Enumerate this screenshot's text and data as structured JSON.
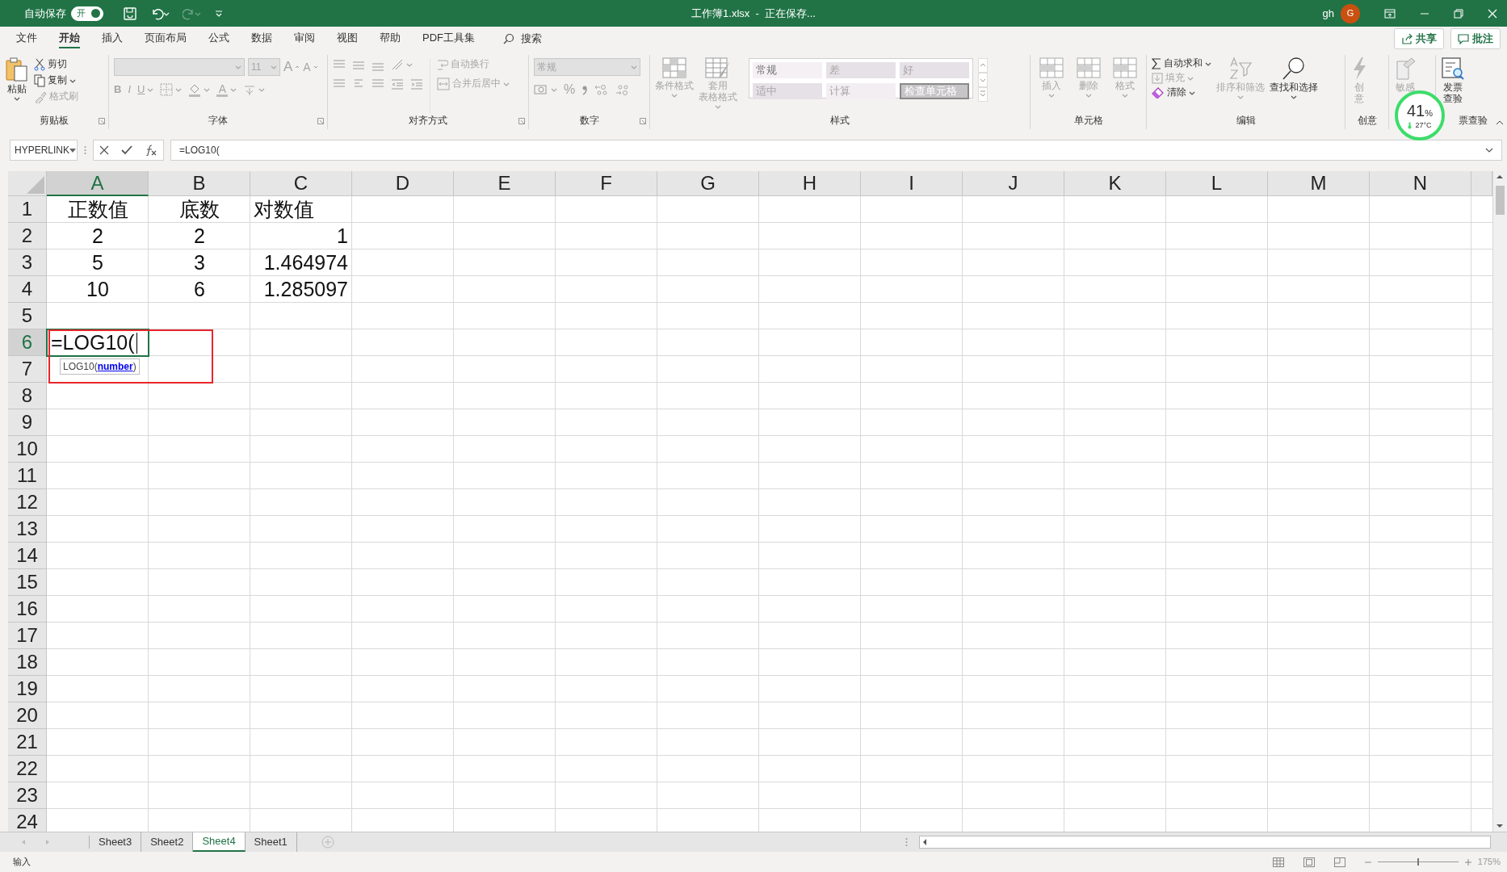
{
  "title_bar": {
    "autosave_label": "自动保存",
    "autosave": {
      "label": "开",
      "on": true
    },
    "title": "工作簿1.xlsx  -  正在保存...",
    "user": "gh",
    "avatar": "G"
  },
  "menu_tabs": [
    {
      "label": "文件",
      "selected": false
    },
    {
      "label": "开始",
      "selected": true
    },
    {
      "label": "插入",
      "selected": false
    },
    {
      "label": "页面布局",
      "selected": false
    },
    {
      "label": "公式",
      "selected": false
    },
    {
      "label": "数据",
      "selected": false
    },
    {
      "label": "审阅",
      "selected": false
    },
    {
      "label": "视图",
      "selected": false
    },
    {
      "label": "帮助",
      "selected": false
    },
    {
      "label": "PDF工具集",
      "selected": false
    }
  ],
  "search": {
    "label": "搜索"
  },
  "share_button": "共享",
  "comments_button": "批注",
  "ribbon": [
    {
      "kind": "clipboard",
      "label": "剪贴板",
      "paste": "粘贴",
      "items": [
        {
          "label": "剪切",
          "disabled": false
        },
        {
          "label": "复制",
          "disabled": false
        },
        {
          "label": "格式刷",
          "disabled": true
        }
      ]
    },
    {
      "kind": "font",
      "label": "字体",
      "font_size": "11",
      "size_buttons": [
        "A",
        "A"
      ],
      "style_buttons": [
        "B",
        "I",
        "U"
      ],
      "color_button": "A"
    },
    {
      "kind": "alignment",
      "label": "对齐方式",
      "wrap": "自动换行",
      "merge": "合并后居中"
    },
    {
      "kind": "number",
      "label": "数字",
      "format": "常规",
      "percent": "%"
    },
    {
      "kind": "styles",
      "label": "样式",
      "buttons": [
        {
          "lines": [
            "条件格式"
          ]
        },
        {
          "lines": [
            "套用",
            "表格格式"
          ]
        }
      ],
      "cell_styles": [
        {
          "label": "常规",
          "color": "#f4f0f4"
        },
        {
          "label": "差",
          "color": "#e6e1e6"
        },
        {
          "label": "好",
          "color": "#e6e1e6"
        },
        {
          "label": "适中",
          "color": "#e6e1e6"
        },
        {
          "label": "计算",
          "color": "#f2eef2"
        },
        {
          "label": "检查单元格",
          "color": "#c8c5c8"
        }
      ]
    },
    {
      "kind": "cells",
      "label": "单元格",
      "buttons": [
        "插入",
        "删除",
        "格式"
      ]
    },
    {
      "kind": "editing",
      "label": "编辑",
      "items": [
        {
          "label": "自动求和",
          "disabled": false
        },
        {
          "label": "填充",
          "disabled": true
        },
        {
          "label": "清除",
          "disabled": false
        }
      ],
      "sort": "排序和筛选",
      "find": "查找和选择"
    },
    {
      "kind": "creative",
      "label": "创意",
      "lines": [
        "创",
        "意"
      ]
    },
    {
      "kind": "sensitivity",
      "lines": [
        "敏感"
      ]
    },
    {
      "kind": "invoice",
      "label": "票查验",
      "lines": [
        "发票",
        "查验"
      ]
    }
  ],
  "monitor": {
    "value": "41",
    "unit": "%",
    "temperature": "27°C"
  },
  "formula_bar": {
    "name_box": "HYPERLINK",
    "formula": "=LOG10("
  },
  "sheet": {
    "columns": [
      {
        "label": "A",
        "selected": true
      },
      {
        "label": "B",
        "selected": false
      },
      {
        "label": "C",
        "selected": false
      },
      {
        "label": "D",
        "selected": false
      },
      {
        "label": "E",
        "selected": false
      },
      {
        "label": "F",
        "selected": false
      },
      {
        "label": "G",
        "selected": false
      },
      {
        "label": "H",
        "selected": false
      },
      {
        "label": "I",
        "selected": false
      },
      {
        "label": "J",
        "selected": false
      },
      {
        "label": "K",
        "selected": false
      },
      {
        "label": "L",
        "selected": false
      },
      {
        "label": "M",
        "selected": false
      },
      {
        "label": "N",
        "selected": false
      }
    ],
    "rows": [
      {
        "label": "1",
        "selected": false,
        "cells": [
          {
            "text": "正数值",
            "kind": "center"
          },
          {
            "text": "底数",
            "kind": "center"
          },
          {
            "text": "对数值",
            "kind": "left"
          }
        ]
      },
      {
        "label": "2",
        "selected": false,
        "cells": [
          {
            "text": "2",
            "kind": "center"
          },
          {
            "text": "2",
            "kind": "center"
          },
          {
            "text": "1",
            "kind": "right"
          }
        ]
      },
      {
        "label": "3",
        "selected": false,
        "cells": [
          {
            "text": "5",
            "kind": "center"
          },
          {
            "text": "3",
            "kind": "center"
          },
          {
            "text": "1.464974",
            "kind": "right"
          }
        ]
      },
      {
        "label": "4",
        "selected": false,
        "cells": [
          {
            "text": "10",
            "kind": "center"
          },
          {
            "text": "6",
            "kind": "center"
          },
          {
            "text": "1.285097",
            "kind": "right"
          }
        ]
      },
      {
        "label": "5",
        "selected": false
      },
      {
        "label": "6",
        "selected": true,
        "editing_cell": {
          "text": "=LOG10(",
          "hint": "LOG10(**number**)"
        }
      },
      {
        "label": "7",
        "selected": false
      },
      {
        "label": "8",
        "selected": false
      },
      {
        "label": "9",
        "selected": false
      },
      {
        "label": "10",
        "selected": false
      },
      {
        "label": "11",
        "selected": false
      },
      {
        "label": "12",
        "selected": false
      },
      {
        "label": "13",
        "selected": false
      },
      {
        "label": "14",
        "selected": false
      },
      {
        "label": "15",
        "selected": false
      },
      {
        "label": "16",
        "selected": false
      },
      {
        "label": "17",
        "selected": false
      },
      {
        "label": "18",
        "selected": false
      },
      {
        "label": "19",
        "selected": false
      },
      {
        "label": "20",
        "selected": false
      },
      {
        "label": "21",
        "selected": false
      },
      {
        "label": "22",
        "selected": false
      },
      {
        "label": "23",
        "selected": false
      },
      {
        "label": "24",
        "selected": false
      }
    ]
  },
  "sheet_tabs": [
    {
      "label": "Sheet3",
      "selected": false
    },
    {
      "label": "Sheet2",
      "selected": false
    },
    {
      "label": "Sheet4",
      "selected": true
    },
    {
      "label": "Sheet1",
      "selected": false
    }
  ],
  "status_bar": {
    "mode": "输入",
    "zoom_slider": {
      "level": 0.5
    },
    "zoom": "175%"
  }
}
